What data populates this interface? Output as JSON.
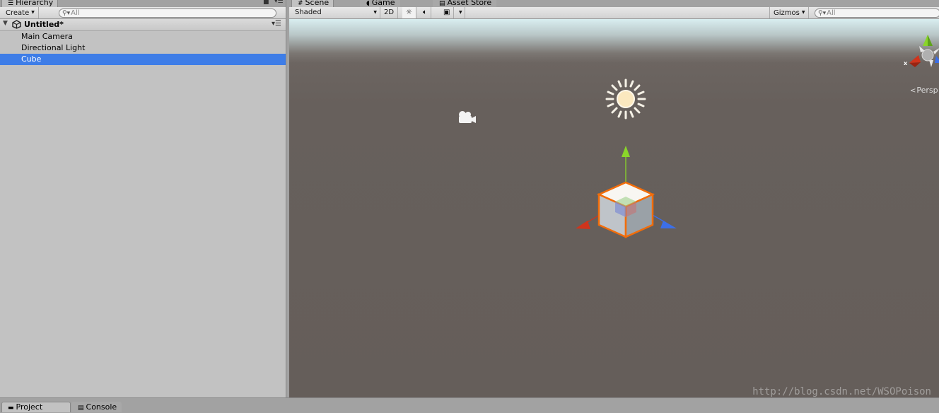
{
  "hierarchy": {
    "tab_label": "Hierarchy",
    "create_label": "Create",
    "search_placeholder": "All",
    "scene_name": "Untitled*",
    "items": [
      {
        "label": "Main Camera",
        "selected": false
      },
      {
        "label": "Directional Light",
        "selected": false
      },
      {
        "label": "Cube",
        "selected": true
      }
    ]
  },
  "scene_view": {
    "tabs": [
      {
        "label": "Scene",
        "icon": "grid-icon",
        "active": true
      },
      {
        "label": "Game",
        "icon": "pacman-icon",
        "active": false
      },
      {
        "label": "Asset Store",
        "icon": "store-icon",
        "active": false
      }
    ],
    "shading_mode": "Shaded",
    "mode_2d_label": "2D",
    "gizmos_label": "Gizmos",
    "search_placeholder": "All",
    "projection_label": "Persp",
    "watermark": "http://blog.csdn.net/WSOPoison"
  },
  "bottom_tabs": [
    {
      "label": "Project",
      "icon": "folder-icon"
    },
    {
      "label": "Console",
      "icon": "console-icon"
    }
  ],
  "colors": {
    "selection": "#3e7de7",
    "axis_x": "#d0341c",
    "axis_y": "#8ad52a",
    "axis_z": "#3c6fe8",
    "selection_outline": "#f26d0a"
  }
}
